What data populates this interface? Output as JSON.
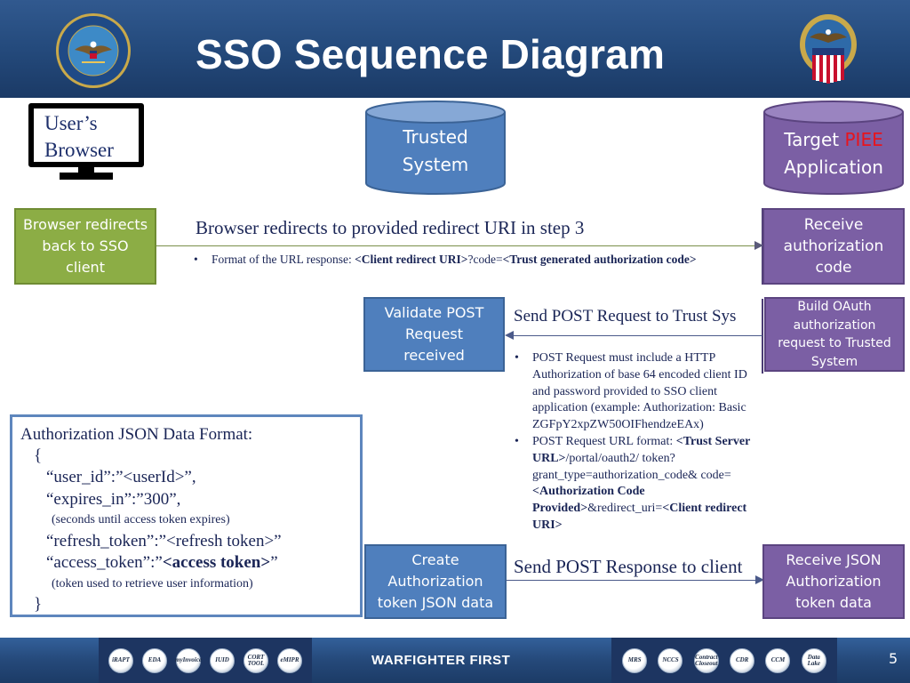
{
  "header": {
    "title": "SSO Sequence Diagram",
    "left_seal": "department-of-defense-seal",
    "right_seal": "defense-logistics-agency-seal"
  },
  "actors": {
    "browser": {
      "line1": "User’s",
      "line2": "Browser",
      "icon": "monitor-icon"
    },
    "trusted": {
      "line1": "Trusted",
      "line2": "System",
      "color": "#4f7fbd"
    },
    "target": {
      "line1_prefix": "Target ",
      "line1_highlight": "PIEE",
      "line2": "Application",
      "color": "#7b5fa4",
      "highlight_color": "#e8141c"
    }
  },
  "boxes": {
    "browser_redirect": "Browser redirects back to SSO client",
    "receive_code": "Receive authorization code",
    "validate_post": "Validate POST Request received",
    "build_oauth": "Build OAuth authorization request to Trusted System",
    "create_token": "Create Authorization token JSON data",
    "receive_json": "Receive JSON Authorization token data"
  },
  "messages": {
    "redirect": {
      "title": "Browser redirects to provided redirect URI in step 3",
      "bullet_prefix": "Format of the URL response: ",
      "bullet_bold1": "<Client redirect URI>",
      "bullet_mid": "?code=",
      "bullet_bold2": "<Trust generated authorization code>"
    },
    "post_request": {
      "title": "Send POST Request to Trust Sys",
      "bullet1": "POST Request must include a HTTP Authorization of base 64 encoded client ID and password provided to SSO client application (example: Authorization: Basic ZGFpY2xpZW50OIFhendzeEAx)",
      "bullet2_prefix": "POST Request URL format: ",
      "bullet2_bold1": "<Trust Server URL>",
      "bullet2_mid1": "/portal/oauth2/ token?grant_type=authorization_code& code=",
      "bullet2_bold2": "<Authorization Code Provided>",
      "bullet2_mid2": "&redirect_uri=",
      "bullet2_bold3": "<Client redirect URI>"
    },
    "post_response": {
      "title": "Send POST Response to client"
    }
  },
  "json_format": {
    "heading": "Authorization JSON Data Format:",
    "open_brace": "{",
    "user_id": "“user_id”:”<userId>”,",
    "expires_in": "“expires_in”:”300”,",
    "expires_note": "(seconds until access token expires)",
    "refresh_token": "“refresh_token”:”<refresh token>”",
    "access_token_prefix": "“access_token”:”",
    "access_token_bold": "<access token>",
    "access_token_suffix": "”",
    "access_note": "(token used to retrieve user information)",
    "close_brace": "}"
  },
  "footer": {
    "slogan": "WARFIGHTER FIRST",
    "page_number": "5",
    "left_logos": [
      "iRAPT",
      "EDA",
      "myInvoice",
      "IUID",
      "CORT TOOL",
      "eMIPR"
    ],
    "right_logos": [
      "MRS",
      "NCCS",
      "Contract Closeout",
      "CDR",
      "CCM",
      "Data Lake"
    ]
  }
}
